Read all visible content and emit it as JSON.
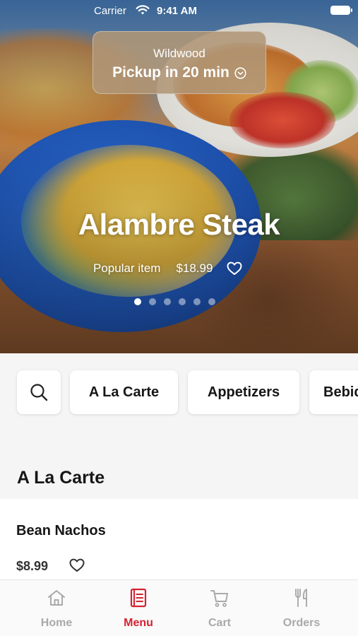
{
  "status_bar": {
    "carrier": "Carrier",
    "time": "9:41 AM"
  },
  "pickup": {
    "store": "Wildwood",
    "eta": "Pickup in 20 min"
  },
  "featured": {
    "name": "Alambre Steak",
    "tag": "Popular item",
    "price": "$18.99",
    "carousel": {
      "count": 6,
      "active_index": 0
    }
  },
  "categories": [
    "A La Carte",
    "Appetizers",
    "Bebidas"
  ],
  "section": {
    "title": "A La Carte"
  },
  "menu_items": [
    {
      "name": "Bean Nachos",
      "price": "$8.99"
    }
  ],
  "tabs": [
    {
      "label": "Home",
      "icon": "home-icon",
      "active": false
    },
    {
      "label": "Menu",
      "icon": "menu-book-icon",
      "active": true
    },
    {
      "label": "Cart",
      "icon": "cart-icon",
      "active": false
    },
    {
      "label": "Orders",
      "icon": "fork-knife-icon",
      "active": false
    }
  ],
  "colors": {
    "accent": "#d42231",
    "inactive_tab": "#a9a9a9",
    "page_bg": "#f5f5f5"
  }
}
